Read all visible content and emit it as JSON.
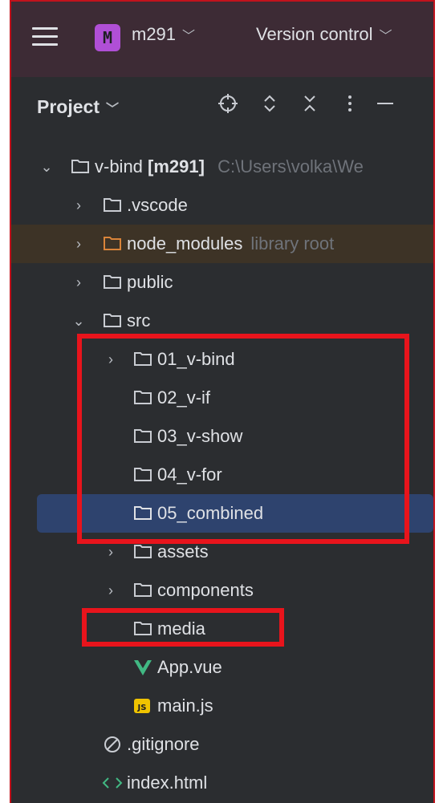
{
  "toolbar": {
    "project_badge": "M",
    "project_name": "m291",
    "vcs_label": "Version control"
  },
  "panel": {
    "title": "Project"
  },
  "icons": {
    "chevron": "chevron-down-icon",
    "locate": "crosshair-icon",
    "expand": "expand-all-icon",
    "collapse": "collapse-all-icon",
    "more": "more-vertical-icon",
    "hide": "minimize-icon"
  },
  "tree": {
    "root_name": "v-bind",
    "root_module": "[m291]",
    "root_path": "C:\\Users\\volka\\We",
    "items": [
      {
        "label": ".vscode"
      },
      {
        "label": "node_modules",
        "hint": "library root"
      },
      {
        "label": "public"
      },
      {
        "label": "src"
      },
      {
        "label": "01_v-bind"
      },
      {
        "label": "02_v-if"
      },
      {
        "label": "03_v-show"
      },
      {
        "label": "04_v-for"
      },
      {
        "label": "05_combined"
      },
      {
        "label": "assets"
      },
      {
        "label": "components"
      },
      {
        "label": "media"
      },
      {
        "label": "App.vue"
      },
      {
        "label": "main.js"
      },
      {
        "label": ".gitignore"
      },
      {
        "label": "index.html"
      }
    ]
  },
  "colors": {
    "toolbar_bg": "#3d2b35",
    "panel_bg": "#2b2d30",
    "selection": "#2e436e",
    "annotation_red": "#e8141c",
    "vue_green": "#41b883",
    "js_yellow": "#f0c400"
  }
}
